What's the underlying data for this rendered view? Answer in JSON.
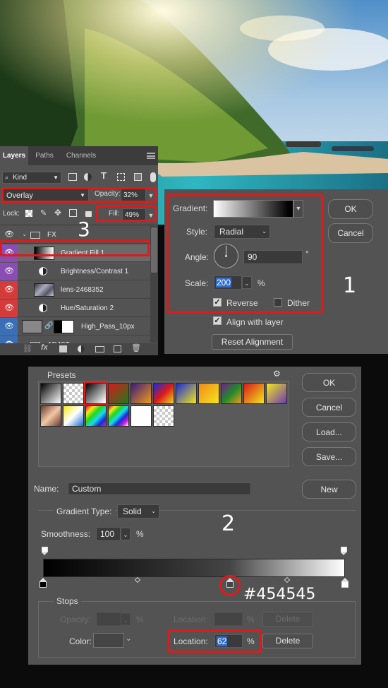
{
  "annotations": {
    "num_1": "1",
    "num_2": "2",
    "num_3": "3",
    "color_hex": "#454545",
    "highlight_color": "#e01a1a"
  },
  "layers_panel": {
    "tabs": [
      "Layers",
      "Paths",
      "Channels"
    ],
    "filter_kind": "Kind",
    "blend_mode": "Overlay",
    "opacity_label": "Opacity:",
    "opacity_value": "32%",
    "lock_label": "Lock:",
    "fill_label": "Fill:",
    "fill_value": "49%",
    "layers": [
      {
        "name": "FX",
        "type": "group",
        "eye_color": "#535353"
      },
      {
        "name": "Gradient Fill 1",
        "type": "gradient",
        "eye_color": "#8a4db3",
        "selected": true
      },
      {
        "name": "Brightness/Contrast 1",
        "type": "adjustment",
        "eye_color": "#8a4db3"
      },
      {
        "name": "lens-2468352",
        "type": "image",
        "eye_color": "#d43b3b"
      },
      {
        "name": "Hue/Saturation 2",
        "type": "adjustment",
        "eye_color": "#d43b3b"
      },
      {
        "name": "High_Pass_10px",
        "type": "masked",
        "eye_color": "#3b6fb5"
      },
      {
        "name": "ADJST",
        "type": "group",
        "eye_color": "#3b6fb5"
      }
    ],
    "footer_icons": [
      "link-icon",
      "fx-icon",
      "mask-icon",
      "adjustment-icon",
      "folder-icon",
      "new-layer-icon",
      "trash-icon"
    ]
  },
  "gradient_fill": {
    "gradient_label": "Gradient:",
    "style_label": "Style:",
    "style_value": "Radial",
    "angle_label": "Angle:",
    "angle_value": "90",
    "angle_unit": "°",
    "scale_label": "Scale:",
    "scale_value": "200",
    "scale_unit": "%",
    "reverse_label": "Reverse",
    "reverse_checked": true,
    "dither_label": "Dither",
    "dither_checked": false,
    "align_label": "Align with layer",
    "align_checked": true,
    "reset_label": "Reset Alignment",
    "ok_label": "OK",
    "cancel_label": "Cancel"
  },
  "gradient_editor": {
    "presets_label": "Presets",
    "ok_label": "OK",
    "cancel_label": "Cancel",
    "load_label": "Load...",
    "save_label": "Save...",
    "name_label": "Name:",
    "name_value": "Custom",
    "new_label": "New",
    "type_label": "Gradient Type:",
    "type_value": "Solid",
    "smoothness_label": "Smoothness:",
    "smoothness_value": "100",
    "smoothness_unit": "%",
    "stops_label": "Stops",
    "opacity_label": "Opacity:",
    "opacity_unit": "%",
    "location_label": "Location:",
    "location_unit": "%",
    "delete_label": "Delete",
    "color_label": "Color:",
    "color_location_label": "Location:",
    "color_location_value": "62",
    "color_location_unit": "%",
    "color_delete_label": "Delete",
    "stop_colors": [
      "#000000",
      "#454545",
      "#ffffff"
    ],
    "stop_locations_pct": [
      0,
      62,
      100
    ]
  }
}
